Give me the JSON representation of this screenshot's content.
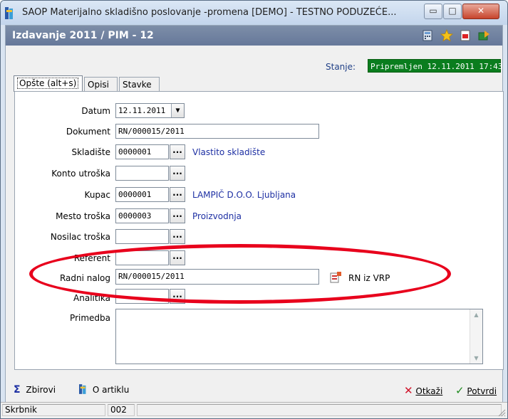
{
  "window": {
    "title": "SAOP Materijalno skladišno poslovanje -promena [DEMO] - TESTNO PODUZEĆE...",
    "minimize_glyph": "▭",
    "maximize_glyph": "□",
    "close_glyph": "✕"
  },
  "header": {
    "title": "Izdavanje 2011 / PIM - 12"
  },
  "stanje": {
    "label": "Stanje:",
    "value": "Pripremljen 12.11.2011 17:43"
  },
  "tabs": [
    {
      "label": "Opšte (alt+s)"
    },
    {
      "label": "Opisi"
    },
    {
      "label": "Stavke"
    }
  ],
  "form": {
    "datum": {
      "label": "Datum",
      "value": "12.11.2011"
    },
    "dokument": {
      "label": "Dokument",
      "value": "RN/000015/2011"
    },
    "skladiste": {
      "label": "Skladište",
      "value": "0000001",
      "link": "Vlastito skladište"
    },
    "konto": {
      "label": "Konto utroška",
      "value": ""
    },
    "kupac": {
      "label": "Kupac",
      "value": "0000001",
      "link": "LAMPIČ D.O.O. Ljubljana"
    },
    "mesto": {
      "label": "Mesto troška",
      "value": "0000003",
      "link": "Proizvodnja"
    },
    "nosilac": {
      "label": "Nosilac troška",
      "value": ""
    },
    "referent": {
      "label": "Referent",
      "value": ""
    },
    "radni_nalog": {
      "label": "Radni nalog",
      "value": "RN/000015/2011",
      "link": "RN iz VRP"
    },
    "analitika": {
      "label": "Analitika",
      "value": ""
    },
    "primedba": {
      "label": "Primedba",
      "value": ""
    }
  },
  "ellipsis": "...",
  "bottom": {
    "zbirovi": "Zbirovi",
    "o_artiklu": "O artiklu",
    "otkazi": "Otkaži",
    "potvrdi": "Potvrdi"
  },
  "status": {
    "user": "Skrbnik",
    "code": "002"
  },
  "colors": {
    "header_bg": "#6f819f",
    "stanje_bg": "#0a7d1e",
    "link": "#1d2fa3",
    "highlight_ellipse": "#e8001c"
  }
}
